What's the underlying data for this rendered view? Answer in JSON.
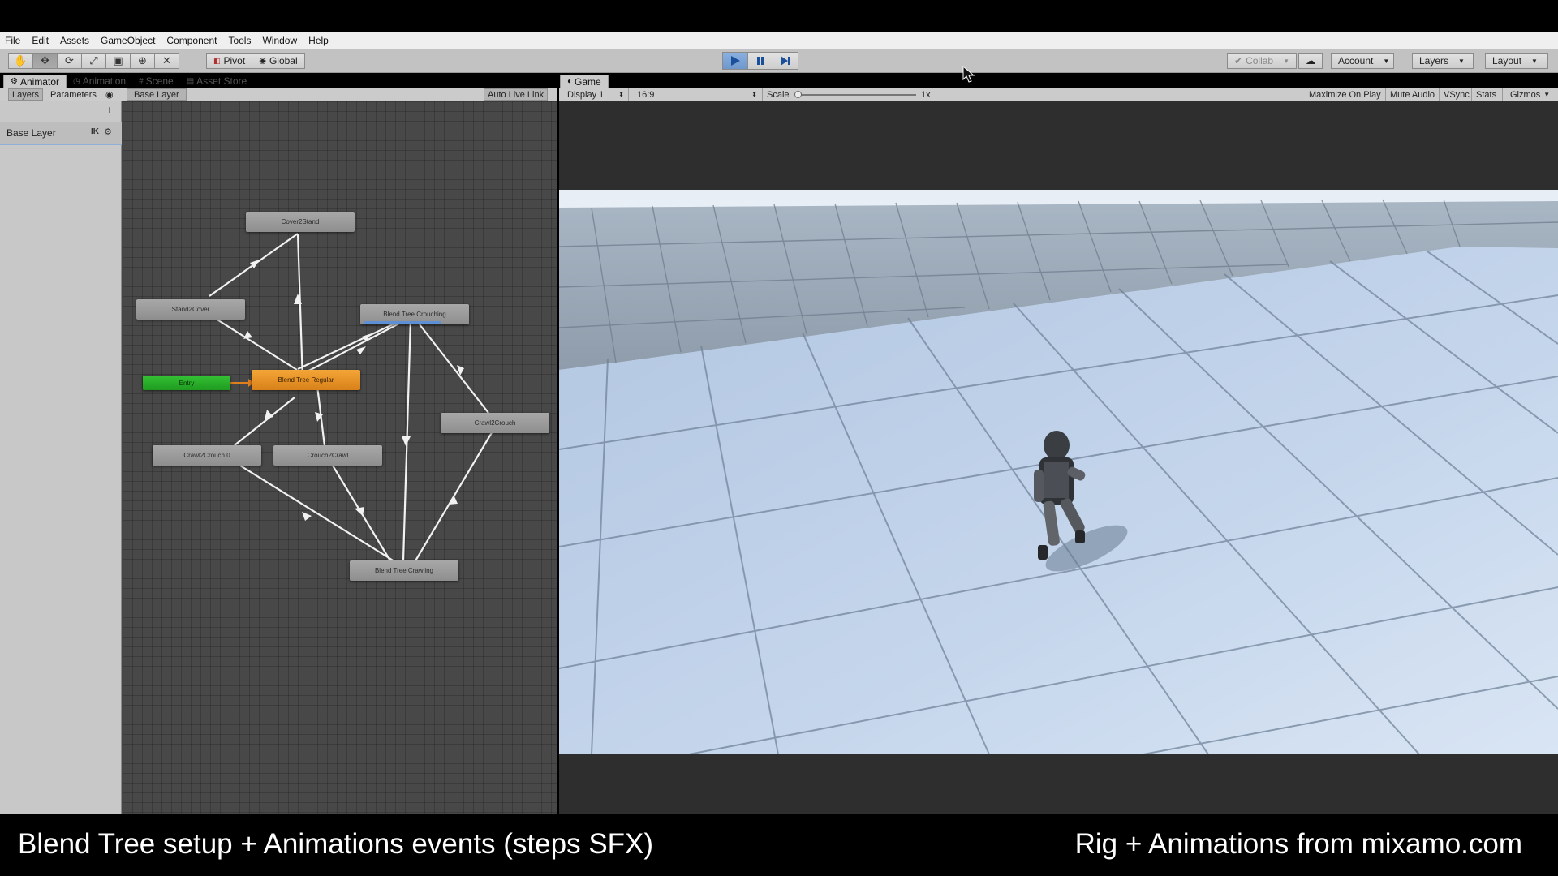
{
  "menu": [
    "File",
    "Edit",
    "Assets",
    "GameObject",
    "Component",
    "Tools",
    "Window",
    "Help"
  ],
  "toolbar": {
    "pivot_label": "Pivot",
    "global_label": "Global",
    "collab_label": "Collab",
    "account_label": "Account",
    "layers_label": "Layers",
    "layout_label": "Layout"
  },
  "left_tabs": {
    "animator": "Animator",
    "animation": "Animation",
    "scene": "Scene",
    "asset_store": "Asset Store"
  },
  "animator": {
    "layers_tab": "Layers",
    "parameters_tab": "Parameters",
    "breadcrumb": "Base Layer",
    "auto_live_link": "Auto Live Link",
    "layer_name": "Base Layer",
    "ik_label": "IK",
    "states": {
      "cover2stand": "Cover2Stand",
      "stand2cover": "Stand2Cover",
      "blend_crouching": "Blend Tree Crouching",
      "entry": "Entry",
      "blend_regular": "Blend Tree Regular",
      "crawl2crouch": "Crawl2Crouch",
      "crawl2crouch0": "Crawl2Crouch 0",
      "crouch2crawl": "Crouch2Crawl",
      "blend_crawling": "Blend Tree Crawling"
    }
  },
  "game": {
    "tab": "Game",
    "display": "Display 1",
    "aspect": "16:9",
    "scale_label": "Scale",
    "scale_value": "1x",
    "scale_fraction": 0.0,
    "maximize": "Maximize On Play",
    "mute": "Mute Audio",
    "vsync": "VSync",
    "stats": "Stats",
    "gizmos": "Gizmos"
  },
  "captions": {
    "left": "Blend Tree setup + Animations events (steps SFX)",
    "right": "Rig + Animations from mixamo.com"
  },
  "colors": {
    "play_active": "#6e97cc",
    "entry_state": "#1f9a1f",
    "default_state": "#d8801a",
    "floor": "#c5d6ec"
  }
}
